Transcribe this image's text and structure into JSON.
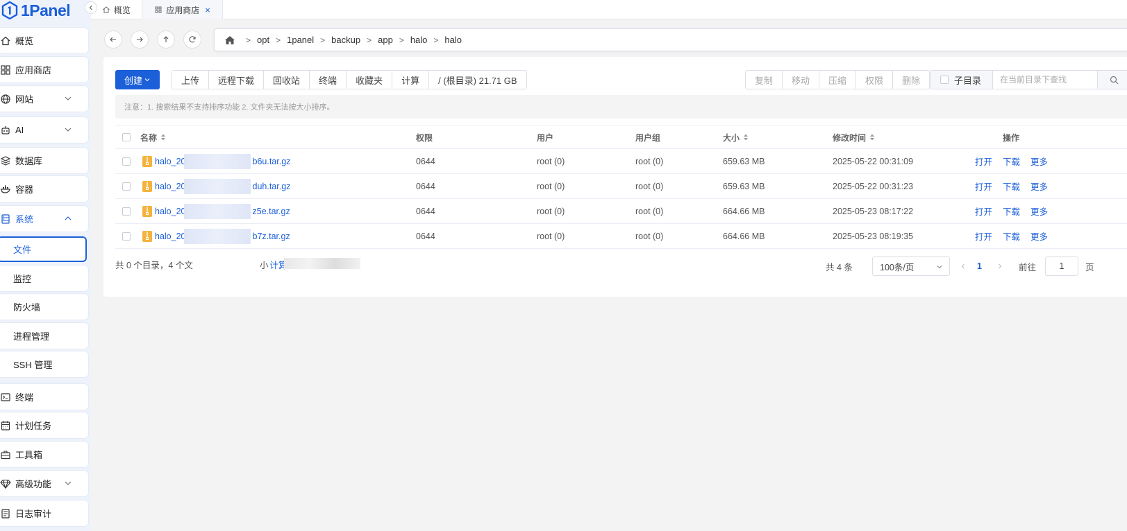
{
  "app": {
    "name": "1Panel"
  },
  "sidebar": {
    "menu": [
      {
        "label": "概览",
        "icon": "home-icon"
      },
      {
        "label": "应用商店",
        "icon": "grid-icon"
      },
      {
        "label": "网站",
        "icon": "globe-icon",
        "expandable": true
      },
      {
        "label": "AI",
        "icon": "robot-icon",
        "expandable": true
      },
      {
        "label": "数据库",
        "icon": "layers-icon"
      },
      {
        "label": "容器",
        "icon": "docker-icon"
      },
      {
        "label": "系统",
        "icon": "server-icon",
        "expandable": true,
        "expanded": true,
        "active": true
      }
    ],
    "system_sub": [
      {
        "label": "文件",
        "selected": true
      },
      {
        "label": "监控"
      },
      {
        "label": "防火墙"
      },
      {
        "label": "进程管理"
      },
      {
        "label": "SSH 管理"
      }
    ],
    "menu_bottom": [
      {
        "label": "终端",
        "icon": "terminal-icon"
      },
      {
        "label": "计划任务",
        "icon": "calendar-icon"
      },
      {
        "label": "工具箱",
        "icon": "toolbox-icon"
      },
      {
        "label": "高级功能",
        "icon": "diamond-icon",
        "expandable": true
      },
      {
        "label": "日志审计",
        "icon": "log-icon"
      }
    ]
  },
  "tabs": [
    {
      "label": "概览",
      "icon": "home-icon"
    },
    {
      "label": "应用商店",
      "icon": "grid-icon",
      "active": true,
      "close": "×"
    }
  ],
  "breadcrumb": [
    "opt",
    "1panel",
    "backup",
    "app",
    "halo",
    "halo"
  ],
  "breadcrumb_sep": ">",
  "toolbar": {
    "create": "创建",
    "left_group": [
      "上传",
      "远程下载",
      "回收站",
      "终端",
      "收藏夹",
      "计算",
      "/ (根目录) 21.71 GB"
    ],
    "right_group": [
      "复制",
      "移动",
      "压缩",
      "权限",
      "删除"
    ],
    "sub_dir": "子目录",
    "search_placeholder": "在当前目录下查找"
  },
  "notice": "注意：1. 搜索结果不支持排序功能 2. 文件夹无法按大小排序。",
  "table": {
    "headers": {
      "name": "名称",
      "perm": "权限",
      "user": "用户",
      "group": "用户组",
      "size": "大小",
      "mtime": "修改时间",
      "ops": "操作"
    },
    "rows": [
      {
        "name_prefix": "halo_20",
        "name_suffix": "b6u.tar.gz",
        "perm": "0644",
        "user": "root (0)",
        "group": "root (0)",
        "size": "659.63 MB",
        "mtime": "2025-05-22 00:31:09"
      },
      {
        "name_prefix": "halo_20",
        "name_suffix": "duh.tar.gz",
        "perm": "0644",
        "user": "root (0)",
        "group": "root (0)",
        "size": "659.63 MB",
        "mtime": "2025-05-22 00:31:23"
      },
      {
        "name_prefix": "halo_20",
        "name_suffix": "z5e.tar.gz",
        "perm": "0644",
        "user": "root (0)",
        "group": "root (0)",
        "size": "664.66 MB",
        "mtime": "2025-05-23 08:17:22"
      },
      {
        "name_prefix": "halo_20",
        "name_suffix": "b7z.tar.gz",
        "perm": "0644",
        "user": "root (0)",
        "group": "root (0)",
        "size": "664.66 MB",
        "mtime": "2025-05-23 08:19:35"
      }
    ],
    "row_ops": [
      "打开",
      "下载",
      "更多"
    ]
  },
  "footer": {
    "summary_start": "共 0 个目录，4 个文",
    "summary_end": "小",
    "calc_link": "计算",
    "total": "共 4 条",
    "page_size": "100条/页",
    "current_page": "1",
    "goto_label": "前往",
    "goto_value": "1",
    "page_unit": "页"
  },
  "colors": {
    "accent": "#1b5fd9",
    "sidebar_bg": "#eef3fb",
    "file_icon": "#f3b33d"
  }
}
